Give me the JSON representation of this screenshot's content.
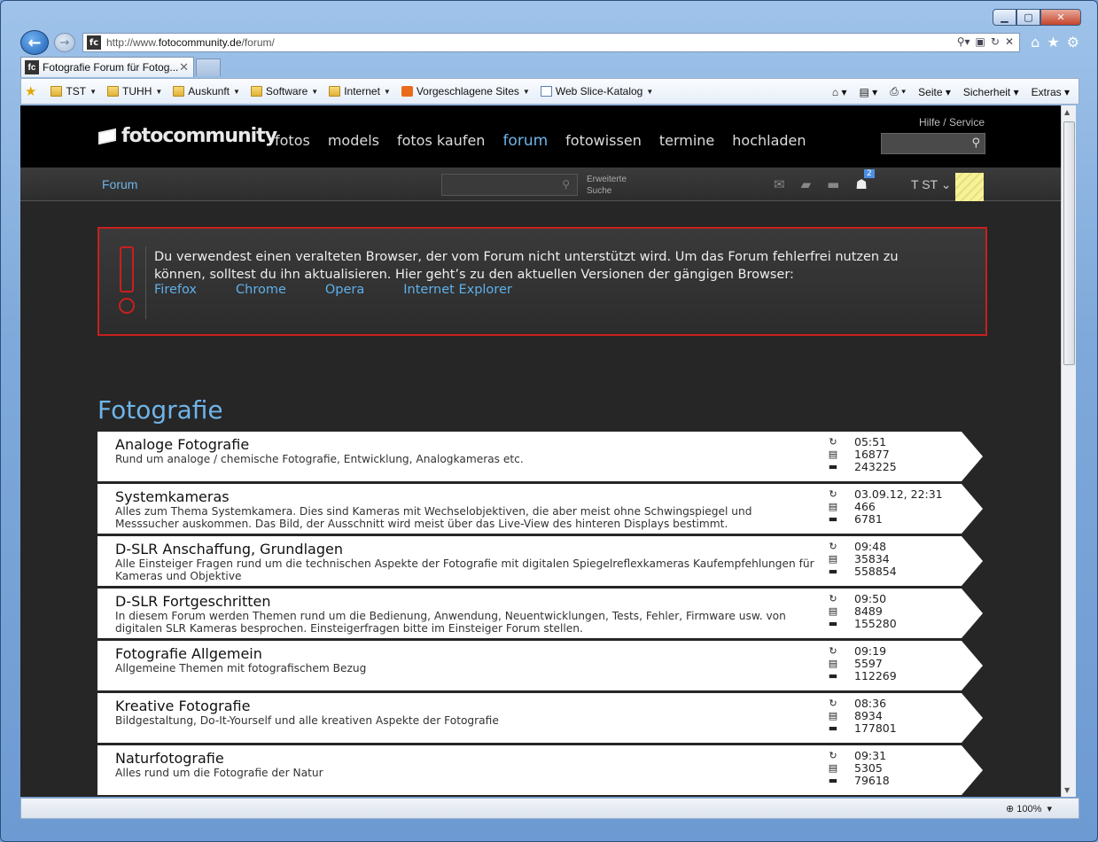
{
  "browser": {
    "url_prefix": "http://www.",
    "url_domain": "fotocommunity.de",
    "url_path": "/forum/",
    "tab_title": "Fotografie Forum für Fotog...",
    "zoom": "100%"
  },
  "favorites": [
    {
      "label": "TST"
    },
    {
      "label": "TUHH"
    },
    {
      "label": "Auskunft"
    },
    {
      "label": "Software"
    },
    {
      "label": "Internet"
    },
    {
      "label": "Vorgeschlagene Sites"
    },
    {
      "label": "Web Slice-Katalog"
    }
  ],
  "command_bar": {
    "seite": "Seite",
    "sicherheit": "Sicherheit",
    "extras": "Extras"
  },
  "site": {
    "logo": "fotocommunity",
    "nav": [
      "fotos",
      "models",
      "fotos kaufen",
      "forum",
      "fotowissen",
      "termine",
      "hochladen"
    ],
    "help": "Hilfe / Service",
    "sub_forum": "Forum",
    "adv_search_1": "Erweiterte",
    "adv_search_2": "Suche",
    "notify_count": "2",
    "user": "T ST"
  },
  "warning": {
    "text": "Du verwendest einen veralteten Browser, der vom Forum nicht unterstützt wird. Um das Forum fehlerfrei nutzen zu können, solltest du ihn aktualisieren. Hier geht’s zu den aktuellen Versionen der gängigen Browser:",
    "links": [
      "Firefox",
      "Chrome",
      "Opera",
      "Internet Explorer"
    ]
  },
  "category": "Fotografie",
  "forums": [
    {
      "name": "Analoge Fotografie",
      "desc": "Rund um analoge / chemische Fotografie, Entwicklung, Analogkameras etc.",
      "last": "05:51",
      "threads": "16877",
      "posts": "243225"
    },
    {
      "name": "Systemkameras",
      "desc": "Alles zum Thema Systemkamera. Dies sind Kameras mit Wechselobjektiven, die aber meist ohne Schwingspiegel und Messsucher auskommen. Das Bild, der Ausschnitt wird meist über das Live-View des hinteren Displays bestimmt.",
      "last": "03.09.12, 22:31",
      "threads": "466",
      "posts": "6781"
    },
    {
      "name": "D-SLR Anschaffung, Grundlagen",
      "desc": "Alle Einsteiger Fragen rund um die technischen Aspekte der Fotografie mit digitalen Spiegelreflexkameras Kaufempfehlungen für Kameras und Objektive",
      "last": "09:48",
      "threads": "35834",
      "posts": "558854"
    },
    {
      "name": "D-SLR Fortgeschritten",
      "desc": "In diesem Forum werden Themen rund um die Bedienung, Anwendung, Neuentwicklungen, Tests, Fehler, Firmware usw. von digitalen SLR Kameras besprochen. Einsteigerfragen bitte im Einsteiger Forum stellen.",
      "last": "09:50",
      "threads": "8489",
      "posts": "155280"
    },
    {
      "name": "Fotografie Allgemein",
      "desc": "Allgemeine Themen mit fotografischem Bezug",
      "last": "09:19",
      "threads": "5597",
      "posts": "112269"
    },
    {
      "name": "Kreative Fotografie",
      "desc": "Bildgestaltung, Do-It-Yourself und alle kreativen Aspekte der Fotografie",
      "last": "08:36",
      "threads": "8934",
      "posts": "177801"
    },
    {
      "name": "Naturfotografie",
      "desc": "Alles rund um die Fotografie der Natur",
      "last": "09:31",
      "threads": "5305",
      "posts": "79618"
    }
  ]
}
